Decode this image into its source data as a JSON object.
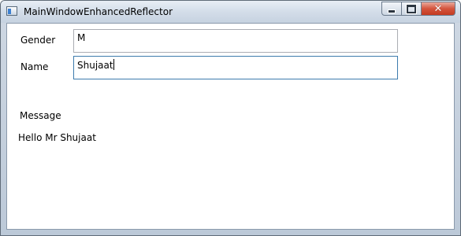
{
  "window": {
    "title": "MainWindowEnhancedReflector"
  },
  "icons": {
    "app": "app-window-icon",
    "minimize": "minimize-icon",
    "maximize": "maximize-icon",
    "close": "close-icon"
  },
  "colors": {
    "close_button": "#c43b22",
    "focus_border": "#3d7bad",
    "textbox_border": "#abadb3"
  },
  "form": {
    "gender_label": "Gender",
    "gender_value": "M",
    "name_label": "Name",
    "name_value": "Shujaat",
    "message_label": "Message",
    "message_text": "Hello Mr Shujaat"
  }
}
